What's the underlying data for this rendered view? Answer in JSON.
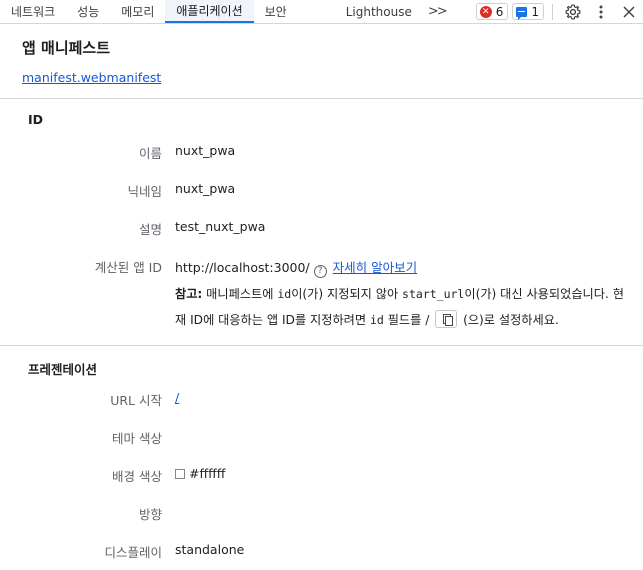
{
  "tabs": [
    {
      "label": "네트워크",
      "active": false
    },
    {
      "label": "성능",
      "active": false
    },
    {
      "label": "메모리",
      "active": false
    },
    {
      "label": "애플리케이션",
      "active": true
    },
    {
      "label": "보안",
      "active": false
    },
    {
      "label": "Lighthouse",
      "active": false
    }
  ],
  "more_tabs": ">>",
  "errors_count": "6",
  "messages_count": "1",
  "header": {
    "title": "앱 매니페스트",
    "link": "manifest.webmanifest"
  },
  "identity": {
    "title": "ID",
    "name_label": "이름",
    "name_value": "nuxt_pwa",
    "short_name_label": "닉네임",
    "short_name_value": "nuxt_pwa",
    "description_label": "설명",
    "description_value": "test_nuxt_pwa",
    "computed_id_label": "계산된 앱 ID",
    "computed_id_value": "http://localhost:3000/",
    "learn_more": "자세히 알아보기",
    "note": {
      "bold": "참고:",
      "t1": " 매니페스트에 ",
      "code1": "id",
      "t2": "이(가) 지정되지 않아 ",
      "code2": "start_url",
      "t3": "이(가) 대신 사용되었습니다. 현재 ID에 대응하는 앱 ID를 지정하려면 ",
      "code3": "id",
      "t4": " 필드를 / ",
      "t5": " (으)로 설정하세요."
    }
  },
  "presentation": {
    "title": "프레젠테이션",
    "start_url_label": "URL 시작",
    "start_url_value": "/",
    "theme_color_label": "테마 색상",
    "background_color_label": "배경 색상",
    "background_color_value": "#ffffff",
    "orientation_label": "방향",
    "display_label": "디스플레이",
    "display_value": "standalone"
  },
  "colors": {
    "accent": "#1a73e8",
    "link": "#1558d6",
    "error": "#d93025",
    "background_swatch": "#ffffff"
  },
  "icons": {
    "errors": "error-circle-icon",
    "messages": "message-icon",
    "settings": "gear-icon",
    "menu": "kebab-menu-icon",
    "close": "close-icon",
    "help": "help-circle-icon",
    "copy": "copy-icon"
  }
}
